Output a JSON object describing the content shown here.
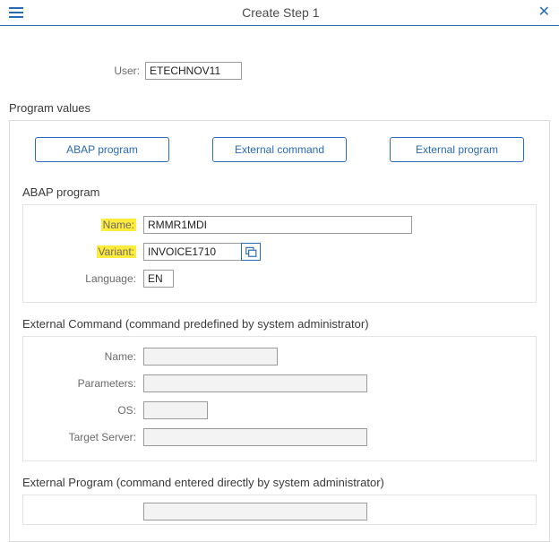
{
  "title": "Create Step  1",
  "user": {
    "label": "User:",
    "value": "ETECHNOV11"
  },
  "section_program_values": "Program values",
  "buttons": {
    "abap": "ABAP program",
    "ext_cmd": "External command",
    "ext_prog": "External program"
  },
  "abap": {
    "title": "ABAP program",
    "name_label": "Name:",
    "name_value": "RMMR1MDI",
    "variant_label": "Variant:",
    "variant_value": "INVOICE1710",
    "language_label": "Language:",
    "language_value": "EN"
  },
  "extcmd": {
    "title": "External Command (command predefined by system administrator)",
    "name_label": "Name:",
    "parameters_label": "Parameters:",
    "os_label": "OS:",
    "target_label": "Target Server:"
  },
  "extprog": {
    "title": "External Program (command entered directly by system administrator)"
  }
}
